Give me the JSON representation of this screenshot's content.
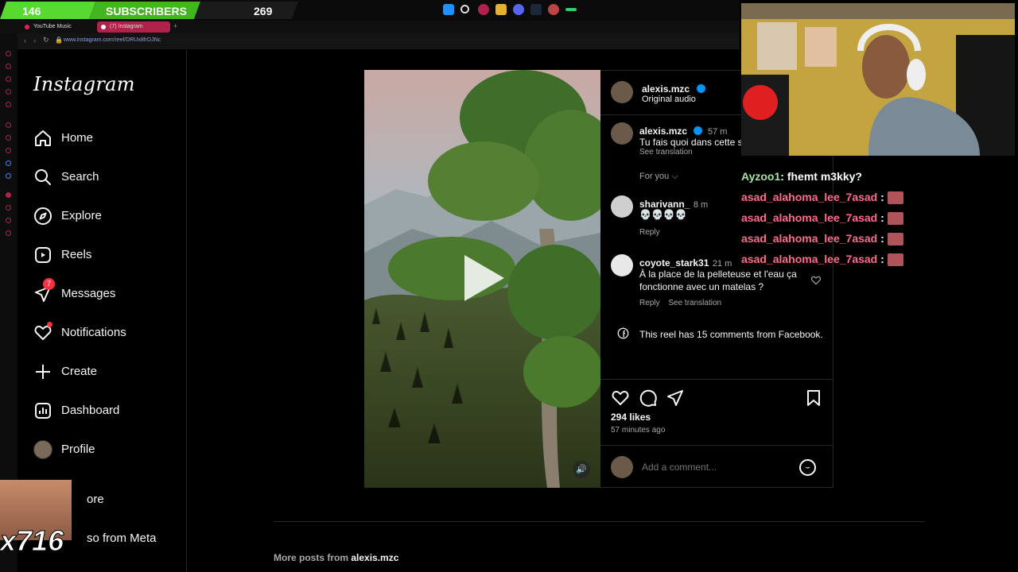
{
  "overlay": {
    "sub_count": "146",
    "sub_label": "SUBSCRIBERS",
    "sub_goal": "269",
    "emote_count": "x716"
  },
  "browser": {
    "tabs": [
      {
        "label": "YouTube Music"
      },
      {
        "label": "(7) Instagram"
      }
    ],
    "url": "www.instagram.com/reel/DRUx8frDJNc"
  },
  "sidebar": {
    "logo": "Instagram",
    "items": [
      {
        "label": "Home",
        "icon": "home-icon"
      },
      {
        "label": "Search",
        "icon": "search-icon"
      },
      {
        "label": "Explore",
        "icon": "compass-icon"
      },
      {
        "label": "Reels",
        "icon": "reels-icon"
      },
      {
        "label": "Messages",
        "icon": "send-icon",
        "badge": "7"
      },
      {
        "label": "Notifications",
        "icon": "heart-icon"
      },
      {
        "label": "Create",
        "icon": "plus-icon"
      },
      {
        "label": "Dashboard",
        "icon": "dashboard-icon"
      },
      {
        "label": "Profile",
        "icon": "avatar"
      },
      {
        "label": "ore",
        "icon": "menu-icon"
      },
      {
        "label": "so from Meta",
        "icon": "meta-icon"
      }
    ]
  },
  "post": {
    "author": "alexis.mzc",
    "audio": "Original audio",
    "likes": "294 likes",
    "time_ago": "57 minutes ago",
    "comment_placeholder": "Add a comment...",
    "more_posts_prefix": "More posts from",
    "more_posts_author": "alexis.mzc"
  },
  "comments": [
    {
      "user": "alexis.mzc",
      "time": "57 m",
      "text": "Tu fais quoi dans cette s",
      "action": "See translation"
    },
    {
      "user": "sharivann_",
      "time": "8 m",
      "text": "💀💀💀💀",
      "action": "Reply"
    },
    {
      "user": "coyote_stark31",
      "time": "21 m",
      "text": "À la place de la pelleteuse et l'eau ça fonctionne avec un matelas ?",
      "action": "Reply",
      "action2": "See translation"
    }
  ],
  "for_you": "For you",
  "facebook_note": "This reel has 15 comments from Facebook.",
  "chat": [
    {
      "user": "Ayzoo1",
      "msg": ": fhemt m3kky?",
      "color": "#a7e3a1"
    },
    {
      "user": "asad_alahoma_lee_7asad",
      "msg": " :",
      "color": "#ff6b8b"
    },
    {
      "user": "asad_alahoma_lee_7asad",
      "msg": " :",
      "color": "#ff6b8b"
    },
    {
      "user": "asad_alahoma_lee_7asad",
      "msg": " :",
      "color": "#ff6b8b"
    },
    {
      "user": "asad_alahoma_lee_7asad",
      "msg": " :",
      "color": "#ff6b8b"
    }
  ]
}
